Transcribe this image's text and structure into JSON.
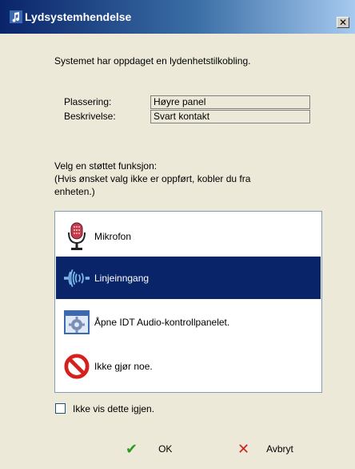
{
  "window": {
    "title": "Lydsystemhendelse",
    "close_glyph": "✕"
  },
  "intro": "Systemet har oppdaget en lydenhetstilkobling.",
  "details": {
    "location_label": "Plassering:",
    "location_value": "Høyre panel",
    "description_label": "Beskrivelse:",
    "description_value": "Svart kontakt"
  },
  "prompt": {
    "line1": "Velg en støttet funksjon:",
    "line2": "(Hvis ønsket valg ikke er oppført, kobler du fra",
    "line3": "enheten.)"
  },
  "options": [
    {
      "label": "Mikrofon",
      "icon": "microphone-icon",
      "selected": false
    },
    {
      "label": "Linjeinngang",
      "icon": "line-in-icon",
      "selected": true
    },
    {
      "label": "Åpne IDT Audio-kontrollpanelet.",
      "icon": "control-panel-icon",
      "selected": false
    },
    {
      "label": "Ikke gjør noe.",
      "icon": "prohibited-icon",
      "selected": false
    }
  ],
  "dont_show": {
    "label": "Ikke vis dette igjen.",
    "checked": false
  },
  "buttons": {
    "ok_label": "OK",
    "cancel_label": "Avbryt"
  },
  "colors": {
    "selection": "#0a246a",
    "ok": "#2e9b1f",
    "cancel": "#d6201b"
  }
}
